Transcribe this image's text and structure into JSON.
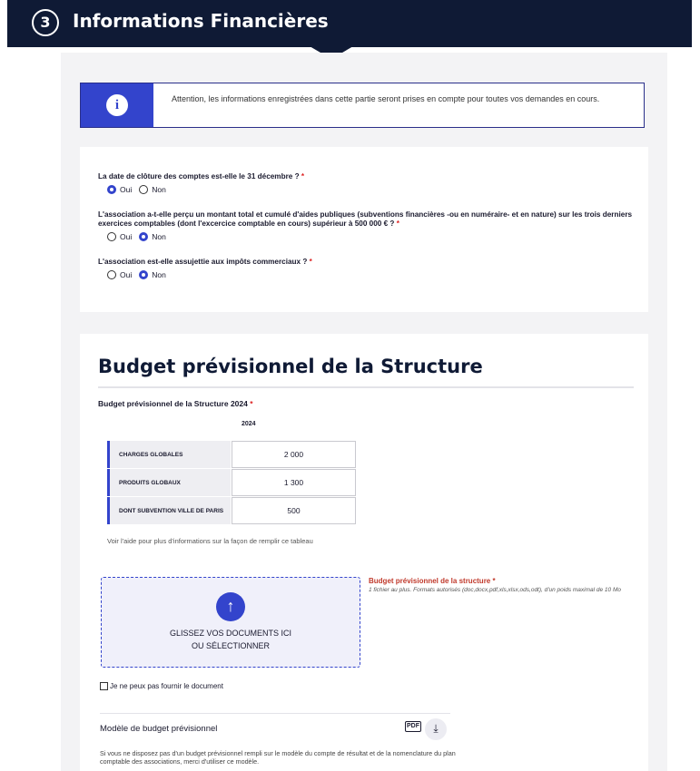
{
  "header": {
    "step_number": "3",
    "title": "Informations Financières"
  },
  "info": {
    "icon": "info-icon",
    "message": "Attention, les informations enregistrées dans cette partie seront prises en compte pour toutes vos demandes en cours."
  },
  "questions": [
    {
      "label": "La date de clôture des comptes est-elle le 31 décembre ?",
      "required_mark": "*",
      "options": [
        "Oui",
        "Non"
      ],
      "selected": "Oui"
    },
    {
      "label": "L'association a-t-elle perçu un montant total et cumulé d'aides publiques (subventions financières -ou en numéraire- et en nature) sur les trois derniers exercices comptables (dont l'excercice comptable en cours) supérieur à 500 000 € ?",
      "required_mark": "*",
      "options": [
        "Oui",
        "Non"
      ],
      "selected": "Non"
    },
    {
      "label": "L'association est-elle assujettie aux impôts commerciaux ?",
      "required_mark": "*",
      "options": [
        "Oui",
        "Non"
      ],
      "selected": "Non"
    }
  ],
  "budget": {
    "section_title": "Budget prévisionnel de la Structure",
    "field_label": "Budget prévisionnel de la Structure 2024",
    "required_mark": "*",
    "year": "2024",
    "rows": [
      {
        "label": "CHARGES GLOBALES",
        "value": "2 000"
      },
      {
        "label": "PRODUITS GLOBAUX",
        "value": "1 300"
      },
      {
        "label": "DONT SUBVENTION VILLE DE PARIS",
        "value": "500"
      }
    ],
    "help": "Voir l'aide pour plus d'informations sur la façon de remplir ce tableau"
  },
  "upload": {
    "drop_line1": "GLISSEZ VOS DOCUMENTS ICI",
    "drop_line2": "OU SÉLECTIONNER",
    "title": "Budget prévisionnel de la structure",
    "required_mark": "*",
    "hint": "1 fichier au plus. Formats autorisés (doc,docx,pdf,xls,xlsx,ods,odt), d'un poids maximal de 10 Mo",
    "cannot_provide": "Je ne peux pas fournir le document"
  },
  "model": {
    "label": "Modèle de budget prévisionnel",
    "pdf_badge": "PDF",
    "download_icon": "download-icon",
    "note": "Si vous ne disposez pas d'un budget prévisionnel rempli sur le modèle du compte de résultat et de la nomenclature du plan comptable des associations, merci d'utiliser ce modèle."
  },
  "colors": {
    "header_bg": "#0f1a35",
    "accent": "#3344cc",
    "required": "#d22222",
    "upload_title": "#c0392b"
  }
}
